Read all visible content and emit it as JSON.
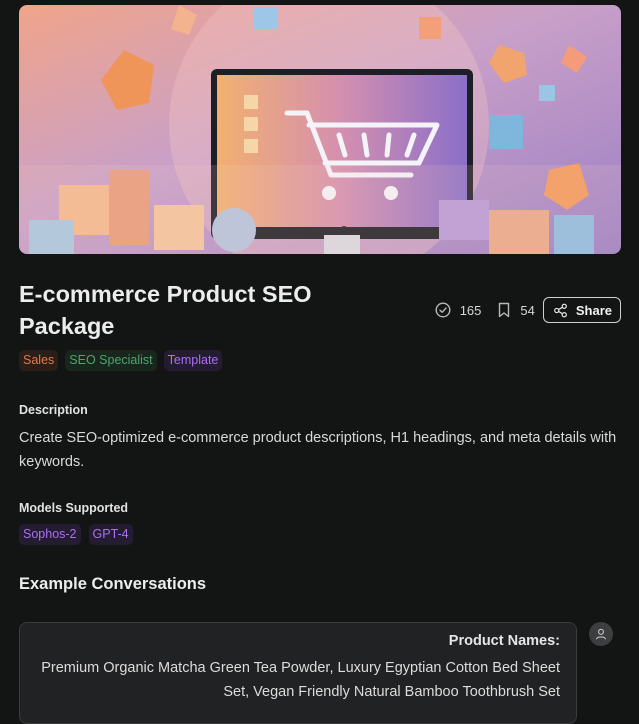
{
  "hero": {
    "alt": "Shopping cart on monitor with gifts and geometric shapes"
  },
  "prompt": {
    "title": "E-commerce Product SEO Package",
    "stats": {
      "uses": "165",
      "saves": "54"
    },
    "share_label": "Share",
    "tags": [
      "Sales",
      "SEO Specialist",
      "Template"
    ]
  },
  "description": {
    "label": "Description",
    "text": "Create SEO-optimized e-commerce product descriptions, H1 headings, and meta details with keywords."
  },
  "models": {
    "label": "Models Supported",
    "items": [
      "Sophos-2",
      "GPT-4"
    ]
  },
  "examples": {
    "title": "Example Conversations",
    "first_message": {
      "heading": "Product Names:",
      "body": "Premium Organic Matcha Green Tea Powder, Luxury Egyptian Cotton Bed Sheet Set, Vegan Friendly Natural Bamboo Toothbrush Set"
    }
  },
  "colors": {
    "background": "#131414",
    "tag_sales": "#e07a45",
    "tag_seo": "#4ea56d",
    "tag_template": "#a970f0"
  },
  "icons": {
    "uses": "check-circle-icon",
    "saves": "bookmark-icon",
    "share": "share-icon",
    "avatar": "user-icon"
  }
}
